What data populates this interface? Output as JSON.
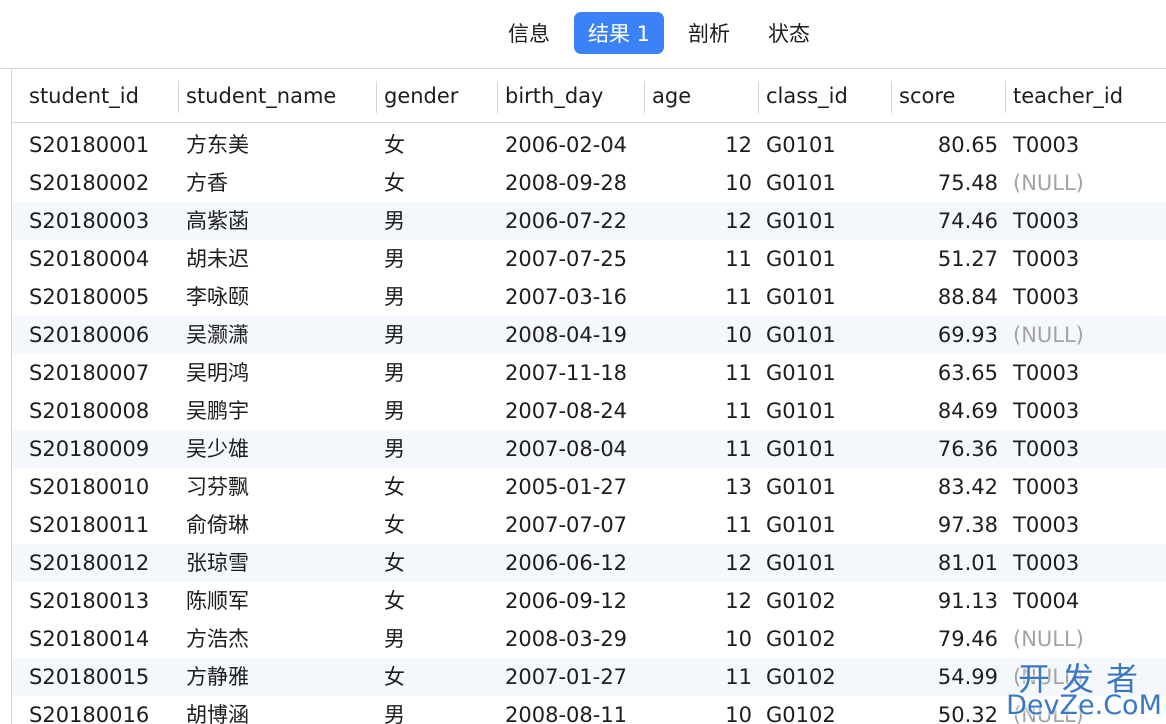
{
  "tabs": [
    {
      "label": "信息",
      "active": false
    },
    {
      "label": "结果 1",
      "active": true
    },
    {
      "label": "剖析",
      "active": false
    },
    {
      "label": "状态",
      "active": false
    }
  ],
  "columns": [
    "student_id",
    "student_name",
    "gender",
    "birth_day",
    "age",
    "class_id",
    "score",
    "teacher_id"
  ],
  "rows": [
    [
      "S20180001",
      "方东美",
      "女",
      "2006-02-04",
      "12",
      "G0101",
      "80.65",
      "T0003"
    ],
    [
      "S20180002",
      "方香",
      "女",
      "2008-09-28",
      "10",
      "G0101",
      "75.48",
      "(NULL)"
    ],
    [
      "S20180003",
      "高紫菡",
      "男",
      "2006-07-22",
      "12",
      "G0101",
      "74.46",
      "T0003"
    ],
    [
      "S20180004",
      "胡未迟",
      "男",
      "2007-07-25",
      "11",
      "G0101",
      "51.27",
      "T0003"
    ],
    [
      "S20180005",
      "李咏颐",
      "男",
      "2007-03-16",
      "11",
      "G0101",
      "88.84",
      "T0003"
    ],
    [
      "S20180006",
      "吴灏潇",
      "男",
      "2008-04-19",
      "10",
      "G0101",
      "69.93",
      "(NULL)"
    ],
    [
      "S20180007",
      "吴明鸿",
      "男",
      "2007-11-18",
      "11",
      "G0101",
      "63.65",
      "T0003"
    ],
    [
      "S20180008",
      "吴鹏宇",
      "男",
      "2007-08-24",
      "11",
      "G0101",
      "84.69",
      "T0003"
    ],
    [
      "S20180009",
      "吴少雄",
      "男",
      "2007-08-04",
      "11",
      "G0101",
      "76.36",
      "T0003"
    ],
    [
      "S20180010",
      "习芬飘",
      "女",
      "2005-01-27",
      "13",
      "G0101",
      "83.42",
      "T0003"
    ],
    [
      "S20180011",
      "俞倚琳",
      "女",
      "2007-07-07",
      "11",
      "G0101",
      "97.38",
      "T0003"
    ],
    [
      "S20180012",
      "张琼雪",
      "女",
      "2006-06-12",
      "12",
      "G0101",
      "81.01",
      "T0003"
    ],
    [
      "S20180013",
      "陈顺军",
      "女",
      "2006-09-12",
      "12",
      "G0102",
      "91.13",
      "T0004"
    ],
    [
      "S20180014",
      "方浩杰",
      "男",
      "2008-03-29",
      "10",
      "G0102",
      "79.46",
      "(NULL)"
    ],
    [
      "S20180015",
      "方静雅",
      "女",
      "2007-01-27",
      "11",
      "G0102",
      "54.99",
      "(NULL)"
    ],
    [
      "S20180016",
      "胡博涵",
      "男",
      "2008-08-11",
      "10",
      "G0102",
      "50.32",
      "(NULL)"
    ]
  ],
  "watermark": {
    "top": "开发者",
    "bottom": "DevZe.CoM"
  },
  "colors": {
    "accent": "#3b82f6",
    "alt_row": "#f4f7fc",
    "null_text": "#a3a3a3",
    "watermark": "#3a78c4"
  }
}
